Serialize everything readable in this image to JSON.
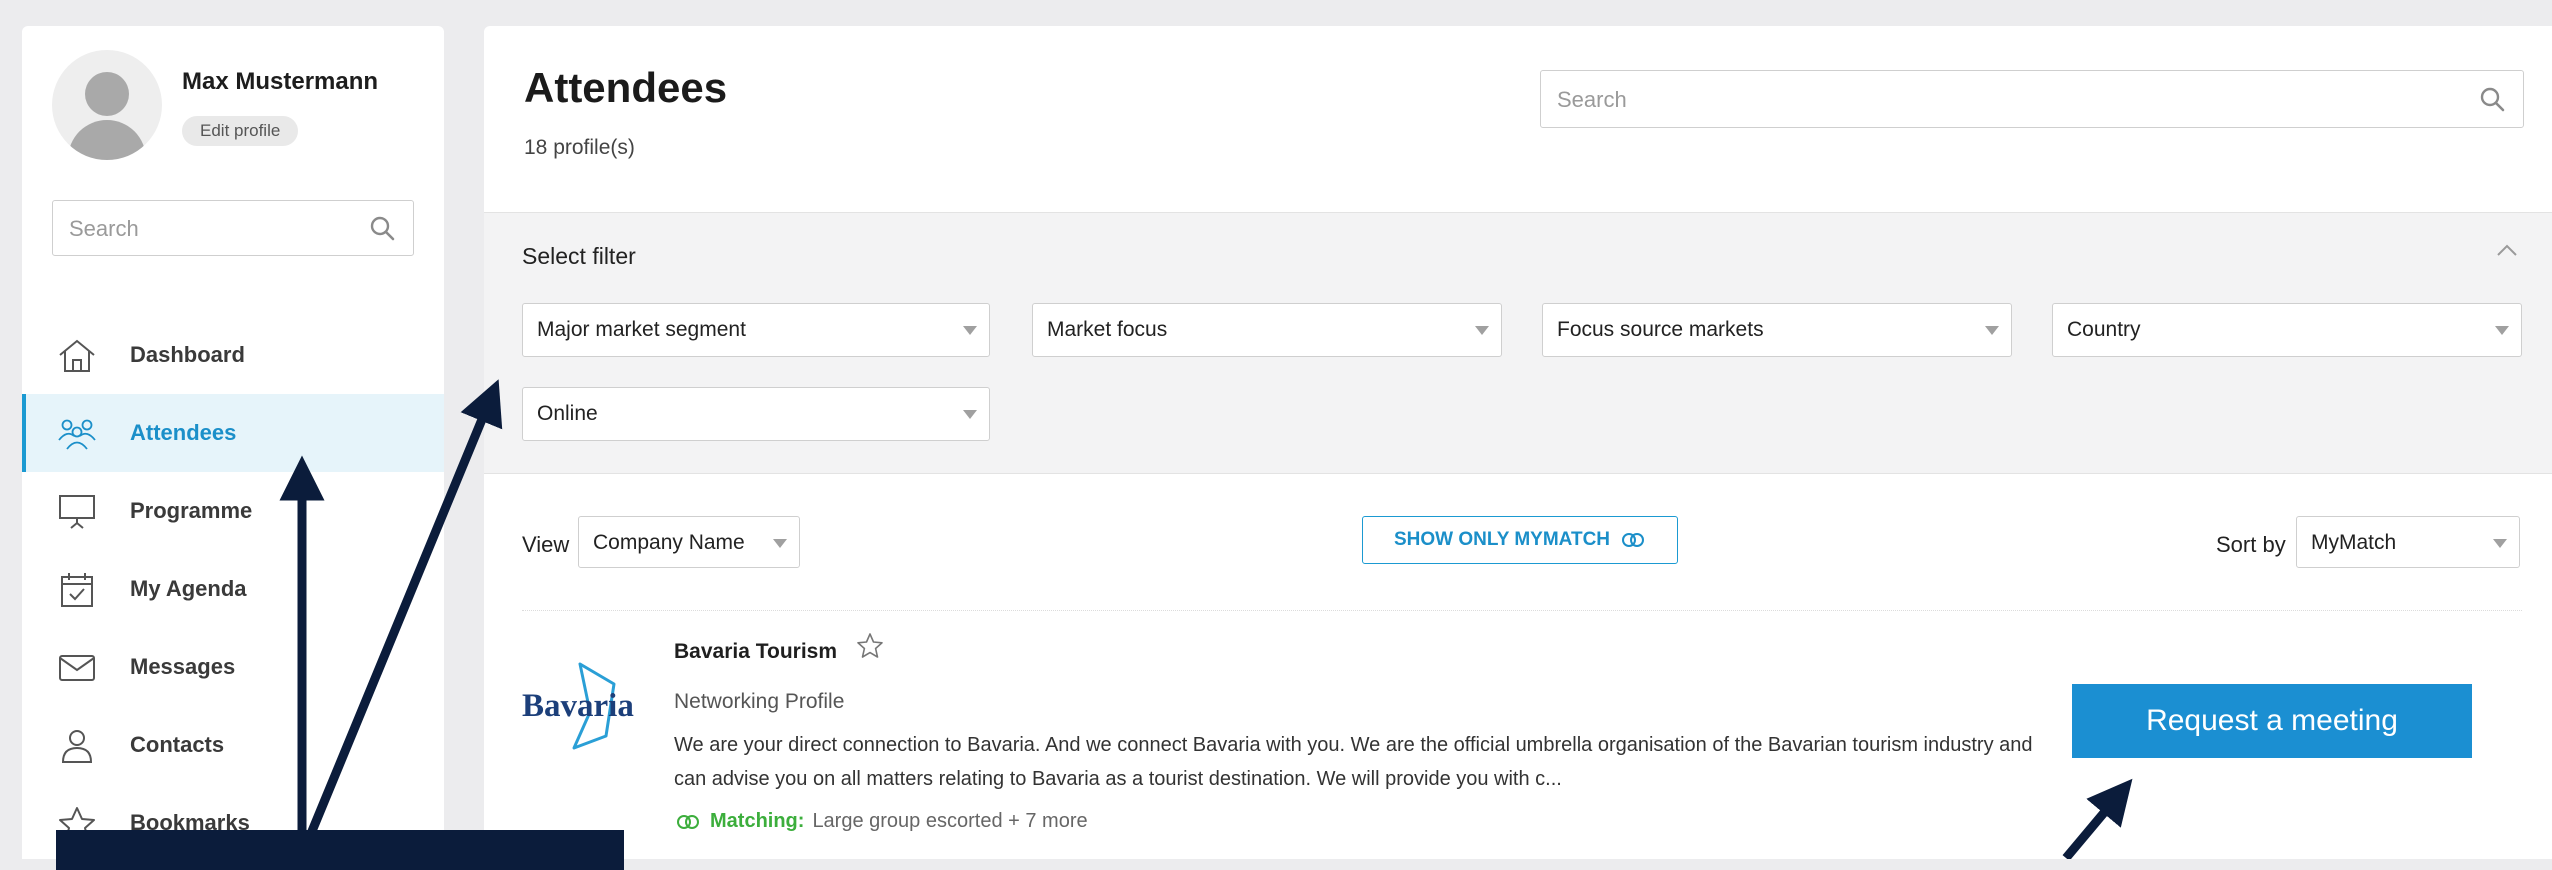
{
  "user": {
    "name": "Max Mustermann",
    "edit_profile_label": "Edit profile"
  },
  "sidebar": {
    "search_placeholder": "Search",
    "items": [
      {
        "label": "Dashboard",
        "icon": "home-icon",
        "active": false
      },
      {
        "label": "Attendees",
        "icon": "people-icon",
        "active": true
      },
      {
        "label": "Programme",
        "icon": "presentation-icon",
        "active": false
      },
      {
        "label": "My Agenda",
        "icon": "calendar-check-icon",
        "active": false
      },
      {
        "label": "Messages",
        "icon": "envelope-icon",
        "active": false
      },
      {
        "label": "Contacts",
        "icon": "person-icon",
        "active": false
      },
      {
        "label": "Bookmarks",
        "icon": "star-icon",
        "active": false
      }
    ]
  },
  "main": {
    "title": "Attendees",
    "profile_count": "18 profile(s)",
    "search_placeholder": "Search",
    "filter": {
      "title": "Select filter",
      "selects": [
        "Major market segment",
        "Market focus",
        "Focus source markets",
        "Country",
        "Online"
      ]
    },
    "view": {
      "label": "View",
      "selected": "Company Name"
    },
    "mymatch_button": "SHOW ONLY MYMATCH",
    "sort": {
      "label": "Sort by",
      "selected": "MyMatch"
    },
    "result": {
      "logo_text": "Bavaria",
      "company_name": "Bavaria Tourism",
      "profile_type": "Networking Profile",
      "description": "We are your direct connection to Bavaria. And we connect Bavaria with you. We are the official umbrella organisation of the Bavarian tourism industry and can advise you on all matters relating to Bavaria as a tourist destination. We will provide you with c...",
      "matching_key": "Matching:",
      "matching_value": "Large group escorted + 7 more",
      "request_button": "Request a meeting"
    }
  },
  "colors": {
    "accent": "#1b9ad2",
    "active_bg": "#e6f4fa",
    "matching_green": "#3cae3c",
    "annotation_navy": "#0b1c3b",
    "button_blue": "#1b8fd2"
  }
}
